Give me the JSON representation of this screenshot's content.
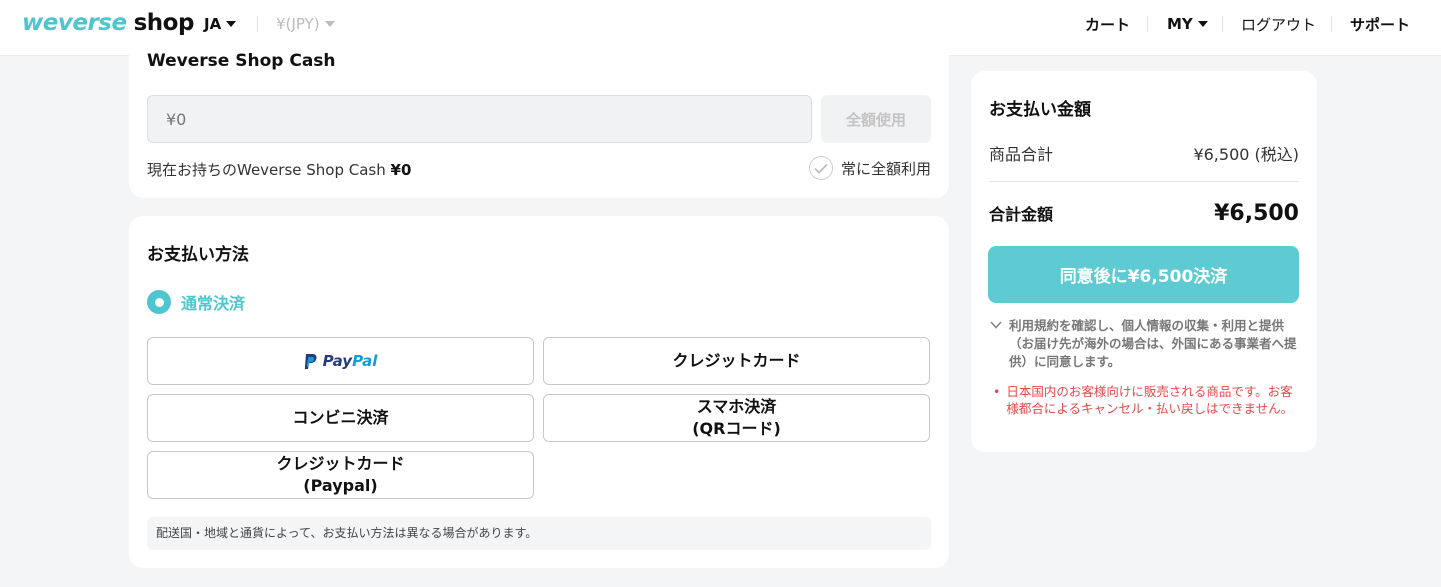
{
  "header": {
    "logo_brand": "weverse",
    "logo_suffix": "shop",
    "language": "JA",
    "currency": "¥(JPY)",
    "cart": "カート",
    "my": "MY",
    "logout": "ログアウト",
    "support": "サポート"
  },
  "cash": {
    "title": "Weverse Shop Cash",
    "input_placeholder": "¥0",
    "use_all_button": "全額使用",
    "balance_label": "現在お持ちのWeverse Shop Cash",
    "balance_value": "¥0",
    "always_use_all": "常に全額利用"
  },
  "payment": {
    "title": "お支払い方法",
    "option_label": "通常決済",
    "methods": {
      "paypal_1": "Pay",
      "paypal_2": "Pal",
      "credit_card": "クレジットカード",
      "convenience": "コンビニ決済",
      "smartphone_1": "スマホ決済",
      "smartphone_2": "(QRコード)",
      "cc_paypal_1": "クレジットカード",
      "cc_paypal_2": "(Paypal)"
    },
    "note": "配送国・地域と通貨によって、お支払い方法は異なる場合があります。"
  },
  "summary": {
    "title": "お支払い金額",
    "subtotal_label": "商品合計",
    "subtotal_value": "¥6,500 (税込)",
    "total_label": "合計金額",
    "total_value": "¥6,500",
    "agree_button": "同意後に¥6,500決済",
    "terms_text": "利用規約を確認し、個人情報の収集・利用と提供（お届け先が海外の場合は、外国にある事業者へ提供）に同意します。",
    "warning_text": "日本国内のお客様向けに販売される商品です。お客様都合によるキャンセル・払い戻しはできません。"
  },
  "colors": {
    "accent": "#4fc5cf",
    "button": "#5ecbd3",
    "warning": "#e54848"
  }
}
